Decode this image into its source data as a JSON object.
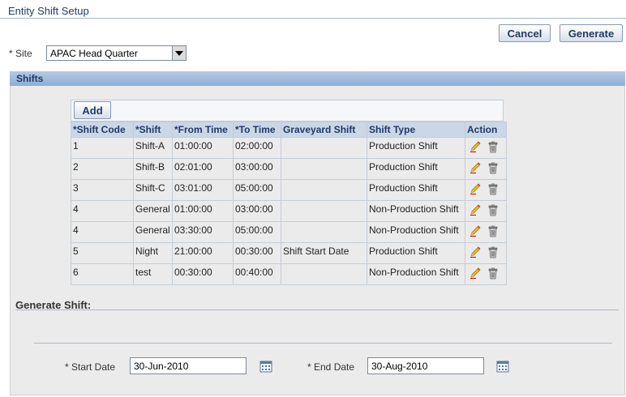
{
  "page": {
    "title": "Entity Shift Setup"
  },
  "toolbar": {
    "cancel_label": "Cancel",
    "generate_label": "Generate"
  },
  "site": {
    "label": "* Site",
    "value": "APAC Head Quarter"
  },
  "shifts_section": {
    "title": "Shifts",
    "add_label": "Add"
  },
  "table": {
    "headers": [
      "*Shift Code",
      "*Shift",
      "*From Time",
      "*To Time",
      "Graveyard Shift",
      "Shift Type",
      "Action"
    ],
    "rows": [
      [
        "1",
        "Shift-A",
        "01:00:00",
        "02:00:00",
        "",
        "Production Shift"
      ],
      [
        "2",
        "Shift-B",
        "02:01:00",
        "03:00:00",
        "",
        "Production Shift"
      ],
      [
        "3",
        "Shift-C",
        "03:01:00",
        "05:00:00",
        "",
        "Production Shift"
      ],
      [
        "4",
        "General",
        "01:00:00",
        "03:00:00",
        "",
        "Non-Production Shift"
      ],
      [
        "4",
        "General",
        "03:30:00",
        "05:00:00",
        "",
        "Non-Production Shift"
      ],
      [
        "5",
        "Night",
        "21:00:00",
        "00:30:00",
        "Shift Start Date",
        "Production Shift"
      ],
      [
        "6",
        "test",
        "00:30:00",
        "00:40:00",
        "",
        "Non-Production Shift"
      ]
    ]
  },
  "generate": {
    "title": "Generate Shift:",
    "start_label": "* Start Date",
    "start_value": "30-Jun-2010",
    "end_label": "* End Date",
    "end_value": "30-Aug-2010"
  },
  "icons": {
    "edit": "pencil-icon",
    "delete": "trash-icon",
    "calendar": "calendar-icon"
  }
}
